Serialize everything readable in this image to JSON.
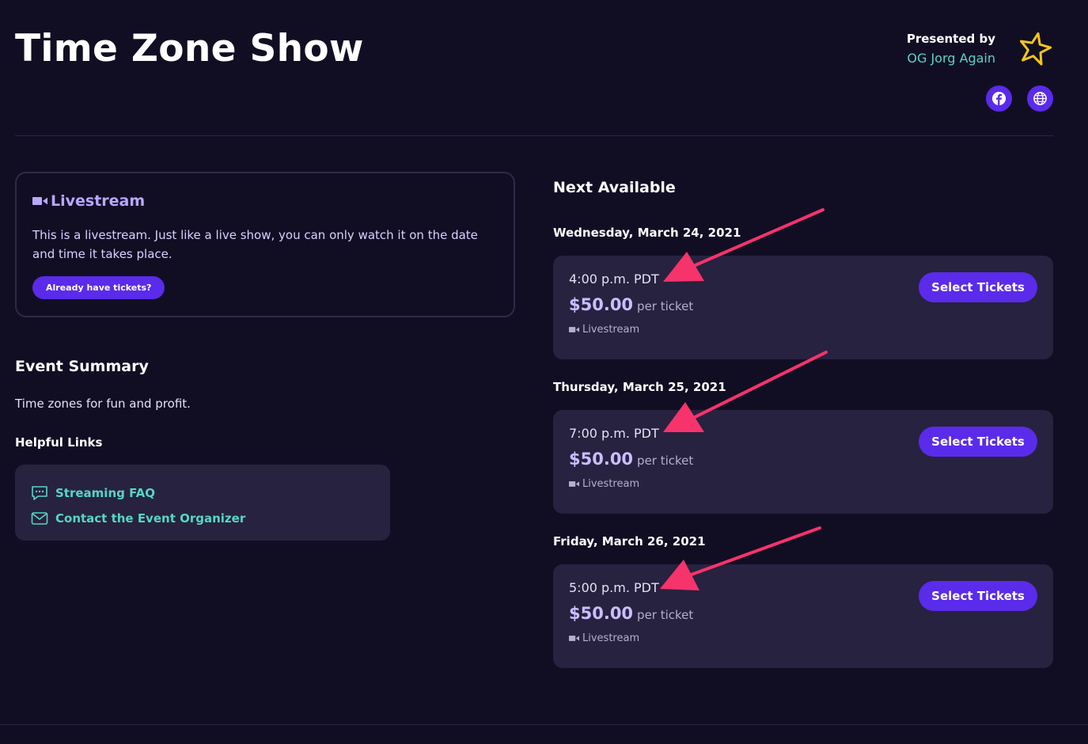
{
  "header": {
    "title": "Time Zone Show",
    "presented_label": "Presented by",
    "presenter_name": "OG Jorg Again"
  },
  "colors": {
    "background": "#110e24",
    "card": "#27223f",
    "accent_purple": "#5a2bea",
    "teal_link": "#56d6c4",
    "lavender": "#b9a7ff",
    "annotation_arrow": "#f7336b",
    "logo_star": "#f5c518"
  },
  "icons": {
    "logo": "star-logo-icon",
    "facebook": "facebook-icon",
    "website": "globe-icon",
    "livestream": "video-camera-icon",
    "faq": "chat-bubble-icon",
    "contact": "envelope-icon"
  },
  "livestream_card": {
    "heading": "Livestream",
    "text": "This is a livestream. Just like a live show, you can only watch it on the date and time it takes place.",
    "button_label": "Already have tickets?"
  },
  "summary": {
    "title": "Event Summary",
    "text": "Time zones for fun and profit.",
    "links_title": "Helpful Links",
    "links": [
      {
        "label": "Streaming FAQ"
      },
      {
        "label": "Contact the Event Organizer"
      }
    ]
  },
  "schedule": {
    "title": "Next Available",
    "shows": [
      {
        "date": "Wednesday, March 24, 2021",
        "time": "4:00 p.m. PDT",
        "price": "$50.00",
        "per": "per ticket",
        "tag": "Livestream",
        "button": "Select Tickets"
      },
      {
        "date": "Thursday, March 25, 2021",
        "time": "7:00 p.m. PDT",
        "price": "$50.00",
        "per": "per ticket",
        "tag": "Livestream",
        "button": "Select Tickets"
      },
      {
        "date": "Friday, March 26, 2021",
        "time": "5:00 p.m. PDT",
        "price": "$50.00",
        "per": "per ticket",
        "tag": "Livestream",
        "button": "Select Tickets"
      }
    ]
  }
}
